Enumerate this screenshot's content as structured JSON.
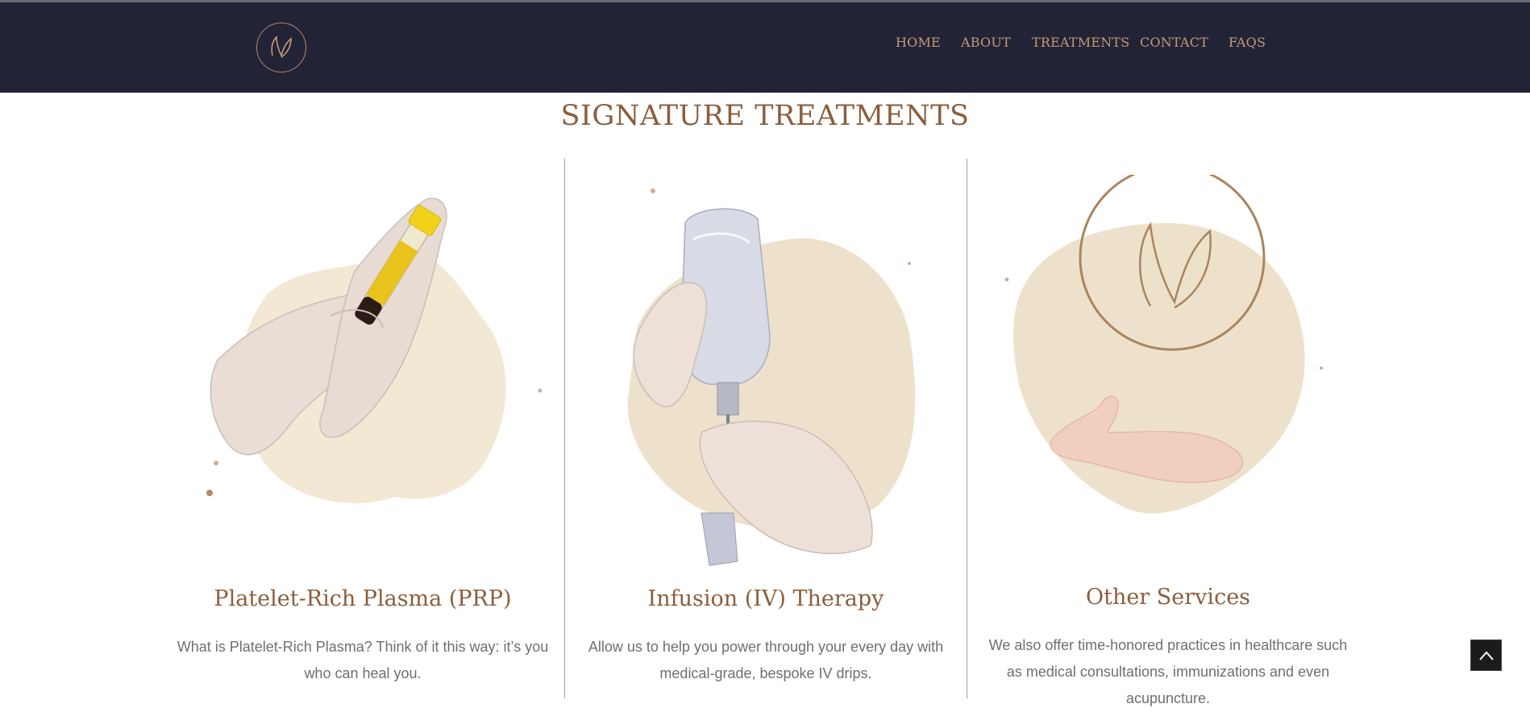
{
  "header": {
    "logo_icon": "leaf-monogram-icon",
    "nav": [
      {
        "label": "HOME"
      },
      {
        "label": "ABOUT"
      },
      {
        "label": "TREATMENTS"
      },
      {
        "label": "CONTACT"
      },
      {
        "label": "FAQS"
      }
    ]
  },
  "section": {
    "title": "SIGNATURE TREATMENTS"
  },
  "cards": [
    {
      "title": "Platelet-Rich Plasma (PRP)",
      "text": "What is Platelet-Rich Plasma? Think of it this way: it’s you who can heal you.",
      "image_icon": "gloved-hands-holding-blood-tube-illustration"
    },
    {
      "title": "Infusion (IV) Therapy",
      "text": "Allow us to help you power through your every day with medical-grade, bespoke IV drips.",
      "image_icon": "gloved-hands-holding-iv-bottle-illustration"
    },
    {
      "title": "Other Services",
      "text": "We also offer time-honored practices in healthcare such as medical consultations, immunizations and even acupuncture.",
      "image_icon": "hand-with-leaf-logo-illustration"
    }
  ],
  "back_to_top_icon": "chevron-up-icon",
  "colors": {
    "navbar_bg": "#222337",
    "accent_gold": "#c49a75",
    "heading_brown": "#8b5e3c",
    "body_text": "#6f6f6f",
    "splash_beige": "#ecdcc4"
  }
}
